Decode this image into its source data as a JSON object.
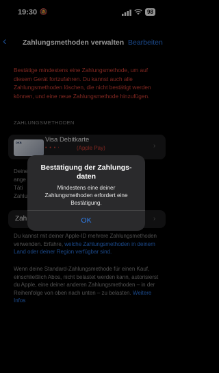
{
  "status_bar": {
    "time": "19:30",
    "battery": "98",
    "icons": [
      "mute-icon",
      "signal-icon",
      "wifi-icon",
      "battery-icon"
    ]
  },
  "nav": {
    "back_icon": "‹",
    "title": "Zahlungsmethoden verwalten",
    "edit_label": "Bearbeiten"
  },
  "warning": "Bestätige mindestens eine Zahlungsmethode, um auf diesem Gerät fortzufahren. Du kannst auch alle Zahlungsmethoden löschen, die nicht bestätigt werden können, und eine neue Zahlungsmethode hinzufügen.",
  "section_header": "ZAHLUNGSMETHODEN",
  "payment_methods": [
    {
      "name": "Visa Debitkarte",
      "masked": "• • • •",
      "subtitle": "(Apple Pay)"
    }
  ],
  "background_text": {
    "desc": "Deine\nange\nTäti\nZahlu",
    "row2_label": "Zah"
  },
  "footer1": {
    "text": "Du kannst mit deiner Apple-ID mehrere Zahlungsmethoden verwenden. Erfahre, ",
    "link": "welche Zahlungsmethoden in deinem Land oder deiner Region verfügbar sind."
  },
  "footer2": {
    "text": "Wenn deine Standard-Zahlungsmethode für einen Kauf, einschließlich Abos, nicht belastet werden kann, autorisierst du Apple, eine deiner anderen Zahlungsmethoden – in der Reihenfolge von oben nach unten – zu belasten. ",
    "link": "Weitere Infos"
  },
  "alert": {
    "title": "Bestätigung der Zahlungs-daten",
    "message": "Mindestens eine deiner Zahlungsmethoden erfordert eine Bestätigung.",
    "ok_label": "OK"
  },
  "colors": {
    "accent": "#2f7ff0",
    "warning": "#e0453a",
    "background": "#000000"
  }
}
